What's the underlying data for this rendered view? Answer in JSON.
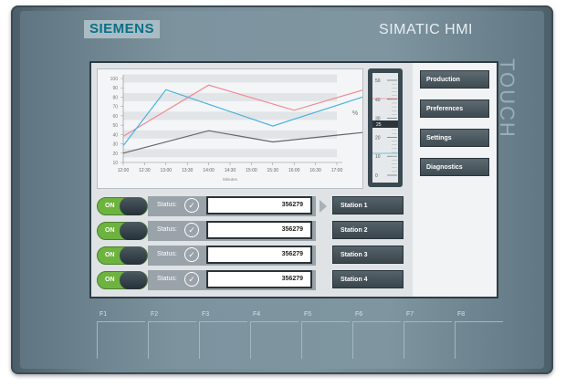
{
  "header": {
    "brand": "SIEMENS",
    "title": "SIMATIC HMI",
    "side_label": "TOUCH"
  },
  "colors": {
    "accent_green": "#6db33f",
    "series_red": "#f08a96",
    "series_blue": "#4ab2e0",
    "series_gray": "#666666"
  },
  "nav": [
    {
      "label": "Production"
    },
    {
      "label": "Preferences"
    },
    {
      "label": "Settings"
    },
    {
      "label": "Diagnostics"
    }
  ],
  "rows": [
    {
      "toggle": "ON",
      "status": "Status:",
      "value": "356279",
      "station": "Station 1"
    },
    {
      "toggle": "ON",
      "status": "Status:",
      "value": "356279",
      "station": "Station 2"
    },
    {
      "toggle": "ON",
      "status": "Status:",
      "value": "356279",
      "station": "Station 3"
    },
    {
      "toggle": "ON",
      "status": "Status:",
      "value": "356279",
      "station": "Station 4"
    }
  ],
  "fkeys": [
    "F1",
    "F2",
    "F3",
    "F4",
    "F5",
    "F6",
    "F7",
    "F8"
  ],
  "gauge": {
    "ticks": [
      "50",
      "40",
      "30",
      "20",
      "10",
      "0"
    ],
    "level_label": "25"
  },
  "chart_data": {
    "type": "line",
    "categories": [
      "12:00",
      "12:30",
      "13:00",
      "13:30",
      "14:00",
      "14:30",
      "15:00",
      "15:30",
      "16:00",
      "16:30",
      "17:00"
    ],
    "ylabel": "%",
    "xlabel": "Minutes",
    "ylim": [
      10,
      100
    ],
    "yticks": [
      "100",
      "90",
      "80",
      "70",
      "60",
      "50",
      "40",
      "30",
      "20",
      "10"
    ],
    "series": [
      {
        "points": [
          [
            0,
            38
          ],
          [
            4,
            93
          ],
          [
            8,
            66
          ],
          [
            12,
            93
          ]
        ]
      },
      {
        "points": [
          [
            0,
            28
          ],
          [
            2,
            88
          ],
          [
            7,
            49
          ],
          [
            12,
            86
          ]
        ]
      },
      {
        "points": [
          [
            0,
            20
          ],
          [
            4,
            44
          ],
          [
            7,
            32
          ],
          [
            12,
            44
          ]
        ]
      }
    ]
  }
}
